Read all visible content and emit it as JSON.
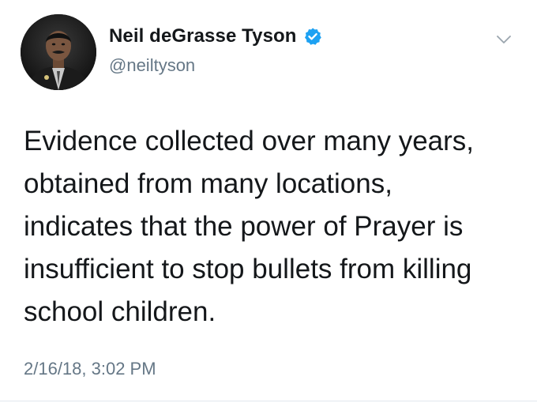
{
  "tweet": {
    "author": {
      "display_name": "Neil deGrasse Tyson",
      "handle": "@neiltyson",
      "verified": true,
      "avatar_icon": "profile-photo"
    },
    "menu_icon": "chevron-down-icon",
    "text_lines": [
      "Evidence collected over many years,",
      "obtained from many locations,",
      "indicates that the power of Prayer is",
      "insufficient to stop bullets from killing",
      "school children."
    ],
    "timestamp": "2/16/18, 3:02 PM"
  },
  "colors": {
    "text_primary": "#14171a",
    "text_secondary": "#657786",
    "verified_blue": "#1da1f2",
    "background": "#ffffff"
  }
}
